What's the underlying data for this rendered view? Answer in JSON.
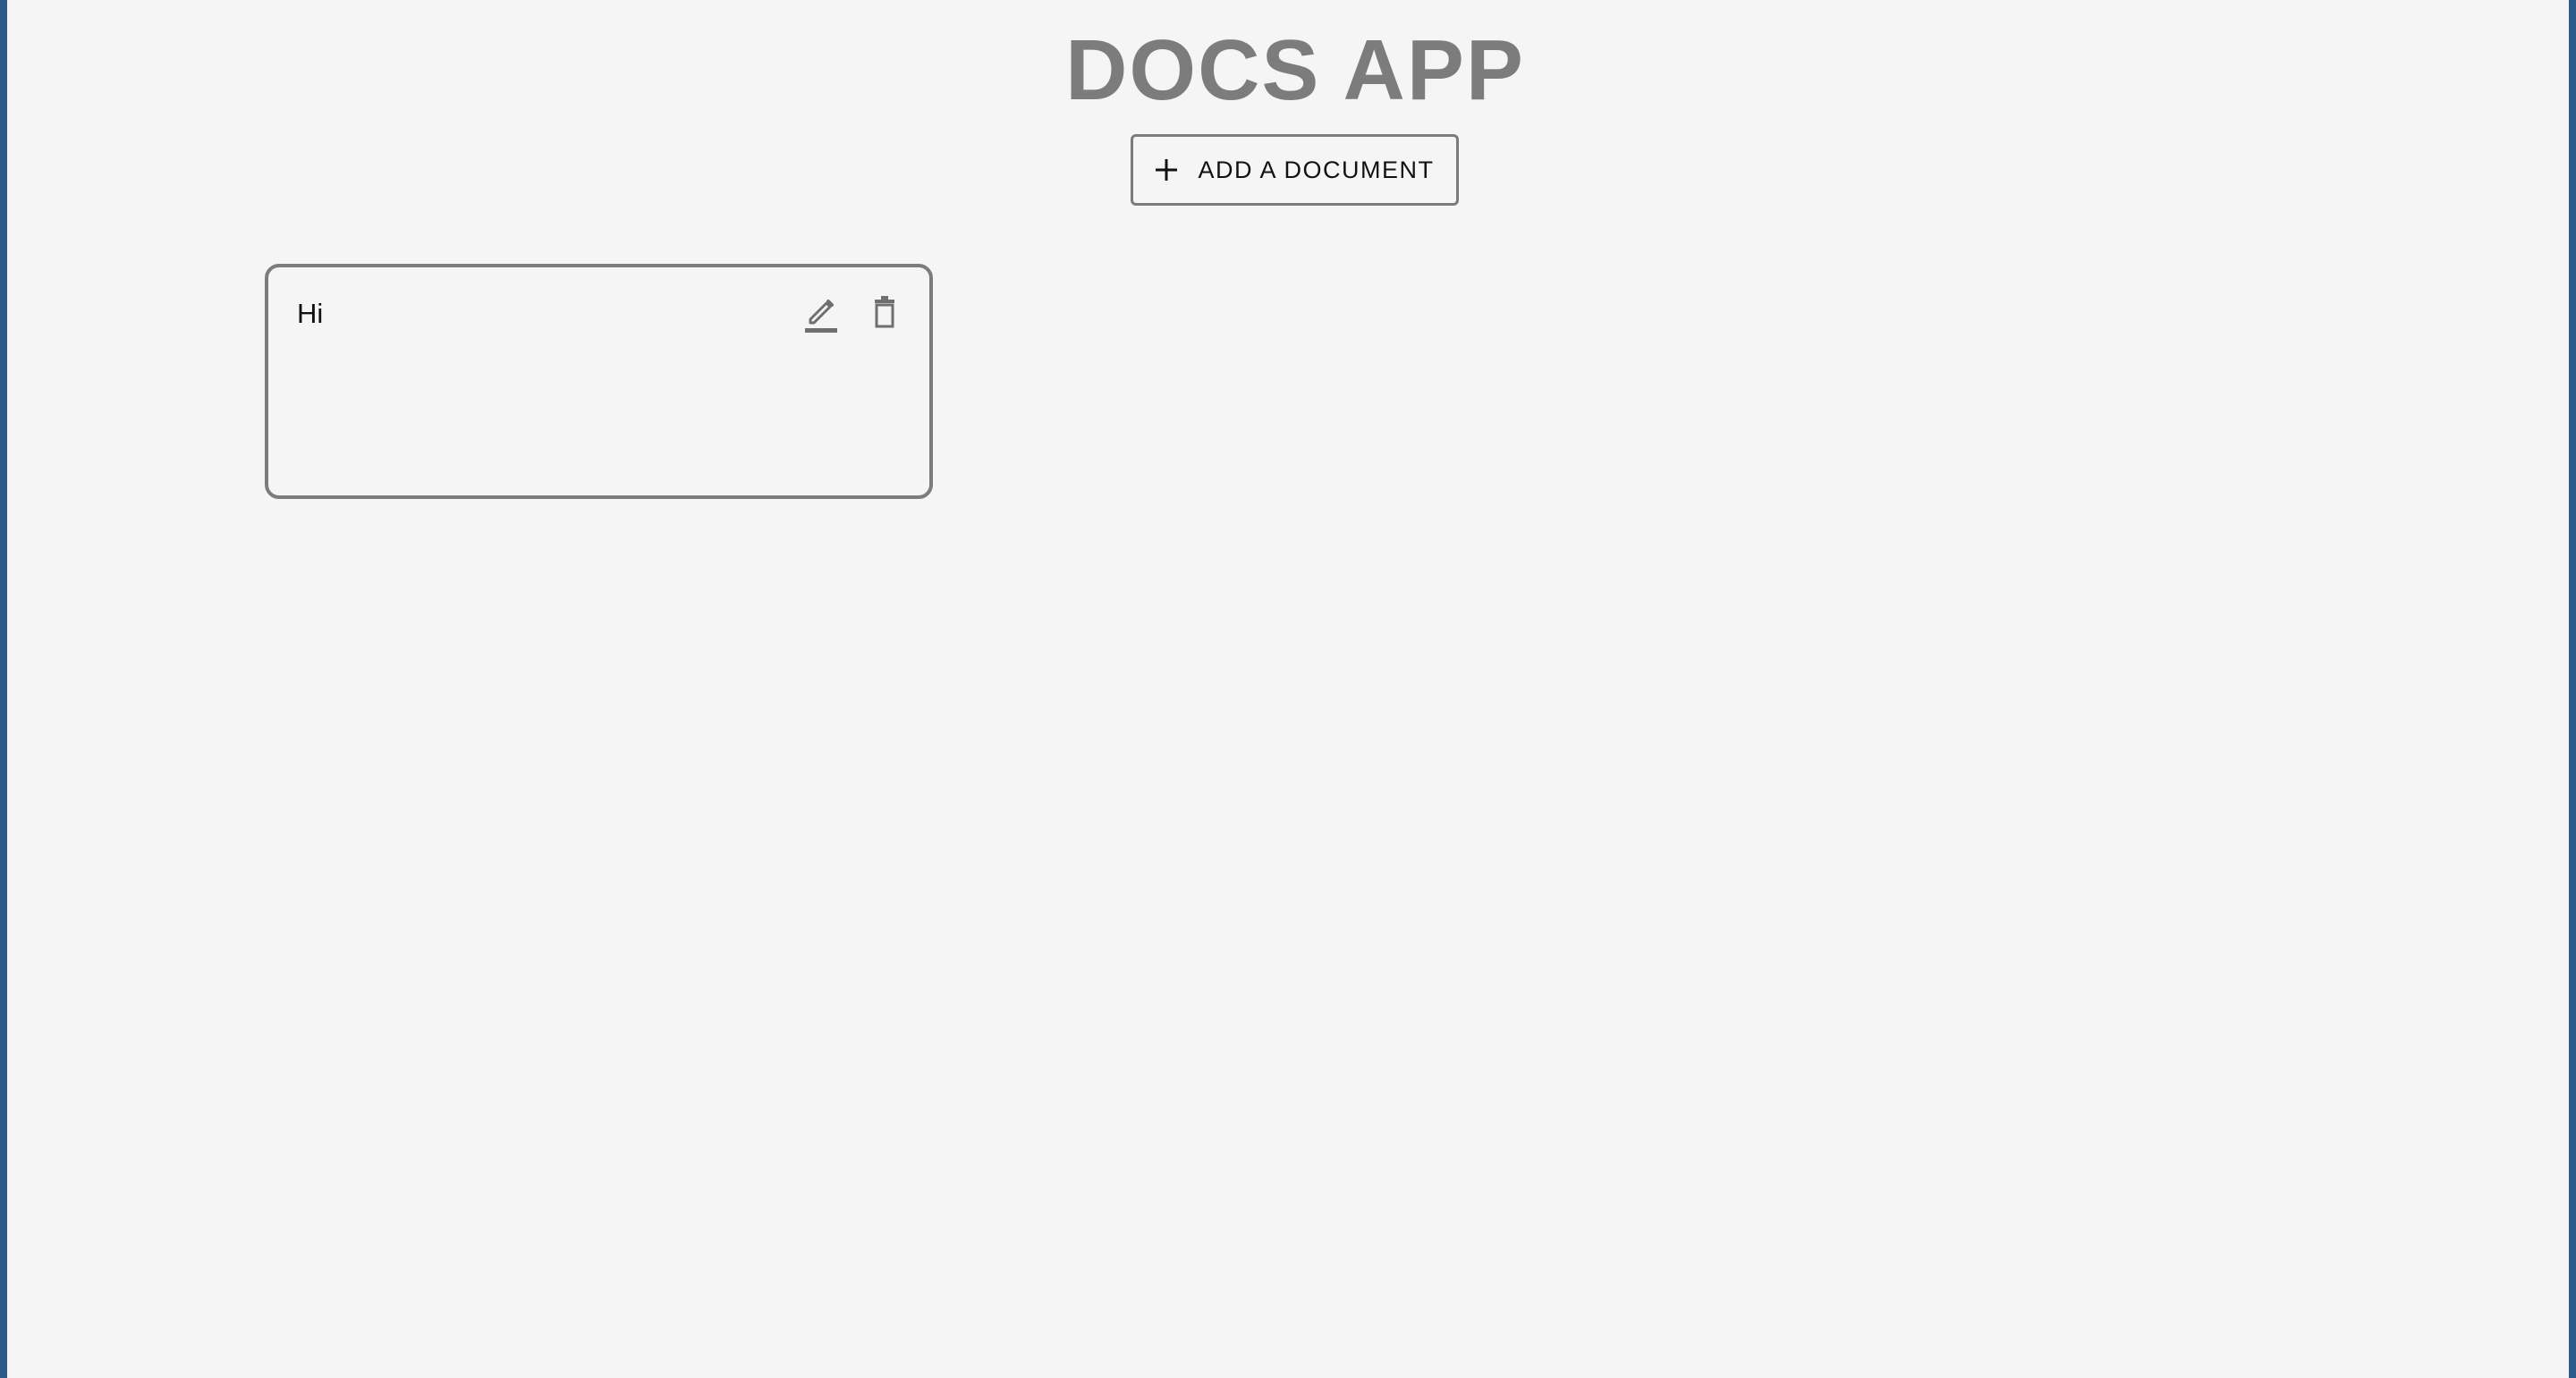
{
  "header": {
    "title": "DOCS APP"
  },
  "actions": {
    "add_document_label": "ADD A DOCUMENT",
    "add_icon": "plus-icon"
  },
  "documents": [
    {
      "title": "Hi",
      "edit_icon": "edit-icon",
      "delete_icon": "delete-icon"
    }
  ],
  "colors": {
    "background": "#f5f5f5",
    "title": "#7c7c7c",
    "border": "#7c7c7c",
    "frame": "#2b5a8a",
    "text": "#111111"
  }
}
